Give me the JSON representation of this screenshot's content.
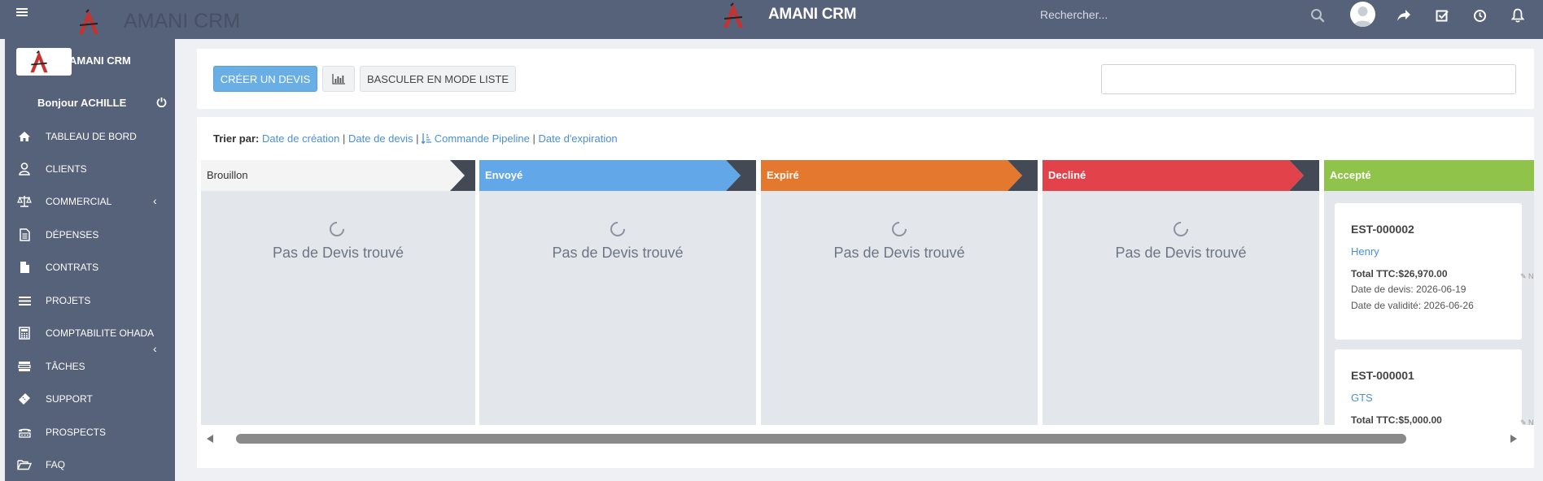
{
  "header": {
    "brand": "AMANI CRM",
    "brand_faint": "AMANI CRM",
    "search_placeholder": "Rechercher..."
  },
  "sidebar": {
    "brand": "AMANI CRM",
    "greeting": "Bonjour ACHILLE",
    "items": [
      {
        "label": "TABLEAU DE BORD",
        "icon": "home-icon"
      },
      {
        "label": "CLIENTS",
        "icon": "user-icon"
      },
      {
        "label": "COMMERCIAL",
        "icon": "balance-scale-icon"
      },
      {
        "label": "DÉPENSES",
        "icon": "file-text-icon"
      },
      {
        "label": "CONTRATS",
        "icon": "file-icon"
      },
      {
        "label": "PROJETS",
        "icon": "bars-icon"
      },
      {
        "label": "COMPTABILITE OHADA",
        "icon": "calculator-icon"
      },
      {
        "label": "TÂCHES",
        "icon": "tasks-icon"
      },
      {
        "label": "SUPPORT",
        "icon": "ticket-icon"
      },
      {
        "label": "PROSPECTS",
        "icon": "tty-icon"
      },
      {
        "label": "FAQ",
        "icon": "folder-open-icon"
      }
    ]
  },
  "toolbar": {
    "create_label": "CRÉER UN DEVIS",
    "list_mode_label": "BASCULER EN MODE LISTE"
  },
  "sort": {
    "label": "Trier par:",
    "options": [
      "Date de création",
      "Date de devis",
      "Commande Pipeline",
      "Date d'expiration"
    ]
  },
  "columns": [
    {
      "title": "Brouillon",
      "color": "#f4f4f4",
      "text_color": "#333333",
      "empty": "Pas de Devis trouvé"
    },
    {
      "title": "Envoyé",
      "color": "#62a8e8",
      "text_color": "#ffffff",
      "empty": "Pas de Devis trouvé"
    },
    {
      "title": "Expiré",
      "color": "#e4782f",
      "text_color": "#ffffff",
      "empty": "Pas de Devis trouvé"
    },
    {
      "title": "Decliné",
      "color": "#e2434b",
      "text_color": "#ffffff",
      "empty": "Pas de Devis trouvé"
    },
    {
      "title": "Accepté",
      "color": "#8fc34a",
      "text_color": "#ffffff",
      "empty": ""
    }
  ],
  "accepted_quotes": [
    {
      "number": "EST-000002",
      "client": "Henry",
      "total": "Total TTC:$26,970.00",
      "date": "Date de devis: 2026-06-19",
      "validity": "Date de validité: 2026-06-26"
    },
    {
      "number": "EST-000001",
      "client": "GTS",
      "total": "Total TTC:$5,000.00",
      "date": "",
      "validity": ""
    }
  ],
  "colors": {
    "header_bg": "#56617a",
    "accent": "#6aaee6",
    "link": "#4a8fd6",
    "column_bg": "#e3e6ea",
    "arrow_dark": "#434a55"
  }
}
